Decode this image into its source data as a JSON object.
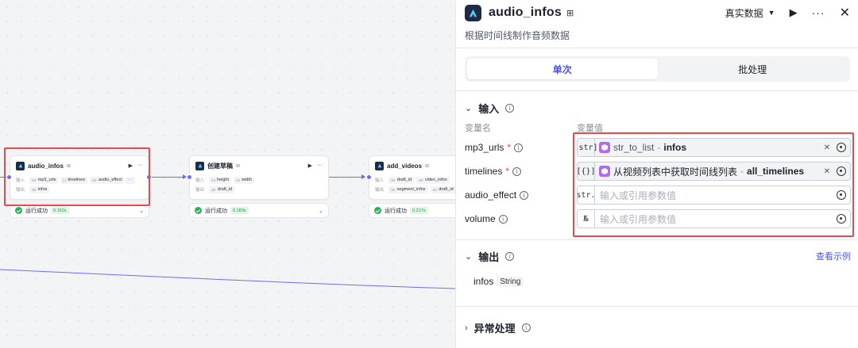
{
  "canvas": {
    "nodes": [
      {
        "title": "audio_infos",
        "input_label": "输入",
        "output_label": "输出",
        "inputs": [
          {
            "type": "Str",
            "name": "mp3_urls"
          },
          {
            "type": "[-]",
            "name": "timelines"
          },
          {
            "type": "Str",
            "name": "audio_effect"
          }
        ],
        "more": "···",
        "outputs": [
          {
            "type": "Str",
            "name": "infos"
          }
        ],
        "status": "运行成功",
        "time": "0.152s"
      },
      {
        "title": "创建草稿",
        "input_label": "输入",
        "output_label": "输出",
        "inputs": [
          {
            "type": "Int",
            "name": "height"
          },
          {
            "type": "Int",
            "name": "width"
          }
        ],
        "outputs": [
          {
            "type": "Str",
            "name": "draft_id"
          }
        ],
        "status": "运行成功",
        "time": "0.183s"
      },
      {
        "title": "add_videos",
        "input_label": "输入",
        "output_label": "输出",
        "inputs": [
          {
            "type": "Str",
            "name": "draft_id"
          },
          {
            "type": "Str",
            "name": "video_infos"
          }
        ],
        "outputs": [
          {
            "type": "Str",
            "name": "segment_infos"
          },
          {
            "type": "Str",
            "name": "draft_id"
          }
        ],
        "status": "运行成功",
        "time": "0.217s"
      }
    ]
  },
  "panel": {
    "title": "audio_infos",
    "description": "根据时间线制作音频数据",
    "mode": "真实数据",
    "tabs": [
      {
        "label": "单次",
        "active": true
      },
      {
        "label": "批处理",
        "active": false
      }
    ],
    "input_section": {
      "title": "输入",
      "col_name": "变量名",
      "col_value": "变量值",
      "rows": [
        {
          "name": "mp3_urls",
          "required": true,
          "type": "[str]",
          "ref_node": "str_to_list",
          "ref_sep": "-",
          "ref_var": "infos"
        },
        {
          "name": "timelines",
          "required": true,
          "type": "[{}]",
          "ref_node": "从视频列表中获取时间线列表",
          "ref_sep": "-",
          "ref_var": "all_timelines"
        },
        {
          "name": "audio_effect",
          "required": false,
          "type": "str.",
          "placeholder": "输入或引用参数值"
        },
        {
          "name": "volume",
          "required": false,
          "type": "№",
          "placeholder": "输入或引用参数值"
        }
      ]
    },
    "output_section": {
      "title": "输出",
      "example_link": "查看示例",
      "outputs": [
        {
          "name": "infos",
          "type": "String"
        }
      ]
    },
    "error_section": {
      "title": "异常处理"
    }
  },
  "colors": {
    "accent": "#4d53e8",
    "edge": "#6a6df5",
    "success": "#26b05a",
    "highlight": "#e5484d",
    "plugin_icon": "#b36af2"
  }
}
